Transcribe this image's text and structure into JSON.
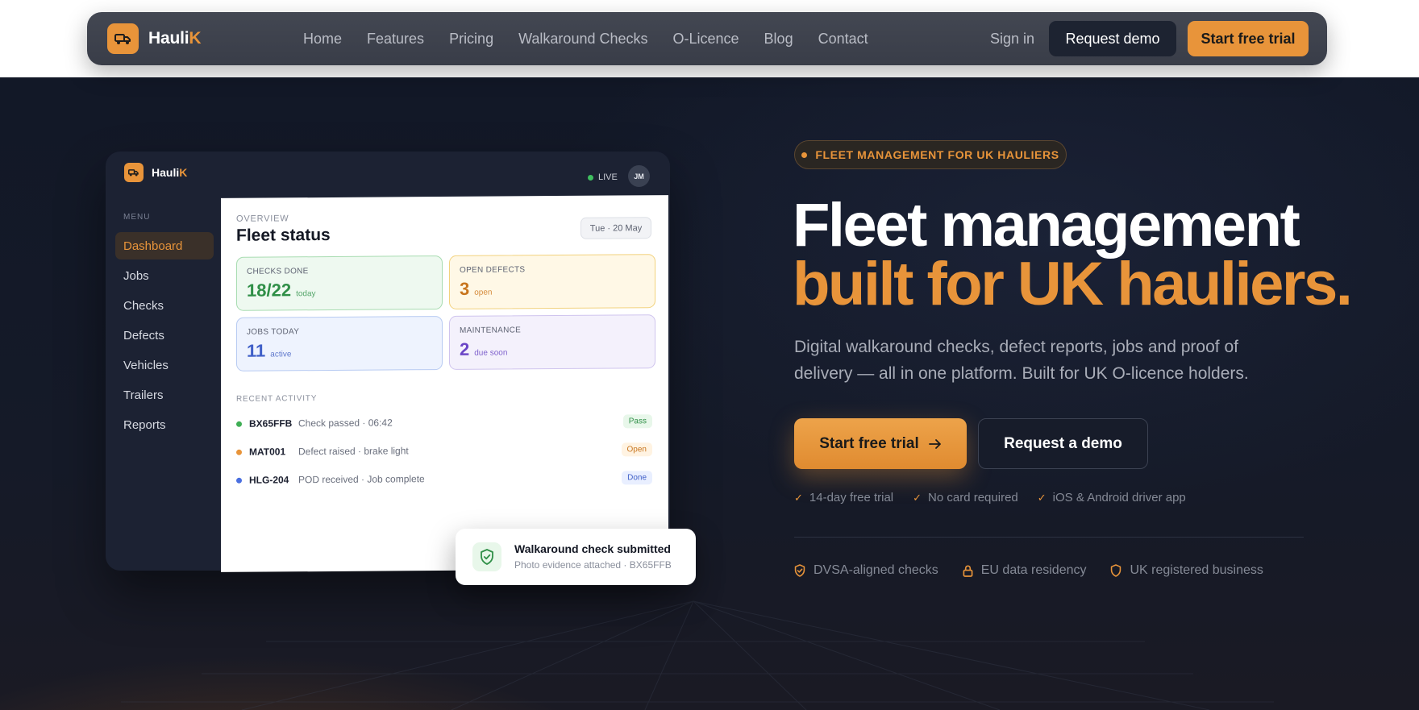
{
  "nav": {
    "brand": {
      "name_main": "Hauli",
      "name_accent": "K"
    },
    "links": [
      "Home",
      "Features",
      "Pricing",
      "Walkaround Checks",
      "O-Licence",
      "Blog",
      "Contact"
    ],
    "signin": "Sign in",
    "request_demo": "Request demo",
    "start_trial": "Start free trial"
  },
  "mock": {
    "brand": {
      "name_main": "Hauli",
      "name_accent": "K"
    },
    "live": "LIVE",
    "avatar": "JM",
    "menu_label": "MENU",
    "menu": [
      "Dashboard",
      "Jobs",
      "Checks",
      "Defects",
      "Vehicles",
      "Trailers",
      "Reports"
    ],
    "active_menu": "Dashboard",
    "overview_label": "OVERVIEW",
    "title": "Fleet status",
    "date": "Tue · 20 May",
    "stats": {
      "checks": {
        "label": "CHECKS DONE",
        "value": "18/22",
        "sub": "today"
      },
      "defects": {
        "label": "OPEN DEFECTS",
        "value": "3",
        "sub": "open"
      },
      "jobs": {
        "label": "JOBS TODAY",
        "value": "11",
        "sub": "active"
      },
      "maintenance": {
        "label": "MAINTENANCE",
        "value": "2",
        "sub": "due soon"
      }
    },
    "recent_label": "RECENT ACTIVITY",
    "activity": [
      {
        "code": "BX65FFB",
        "desc": "Check passed · 06:42",
        "badge": "Pass"
      },
      {
        "code": "MAT001",
        "desc": "Defect raised · brake light",
        "badge": "Open"
      },
      {
        "code": "HLG-204",
        "desc": "POD received · Job complete",
        "badge": "Done"
      }
    ]
  },
  "toast": {
    "title": "Walkaround check submitted",
    "subtitle": "Photo evidence attached · BX65FFB"
  },
  "hero": {
    "pill": "FLEET MANAGEMENT FOR UK HAULIERS",
    "headline_line1": "Fleet management",
    "headline_line2": "built for UK hauliers.",
    "lead": "Digital walkaround checks, defect reports, jobs and proof of delivery — all in one platform. Built for UK O-licence holders.",
    "cta_primary": "Start free trial",
    "cta_secondary": "Request a demo",
    "checks": [
      "14-day free trial",
      "No card required",
      "iOS & Android driver app"
    ],
    "trust": [
      "DVSA-aligned checks",
      "EU data residency",
      "UK registered business"
    ]
  },
  "colors": {
    "accent": "#e8943a",
    "dark": "#121827",
    "nav": "#3e424d"
  },
  "icons": {
    "brand": "truck-icon",
    "toast": "shield-check-icon",
    "arrow": "arrow-right-icon",
    "check": "check-icon",
    "lock": "lock-icon",
    "shield": "shield-icon"
  }
}
